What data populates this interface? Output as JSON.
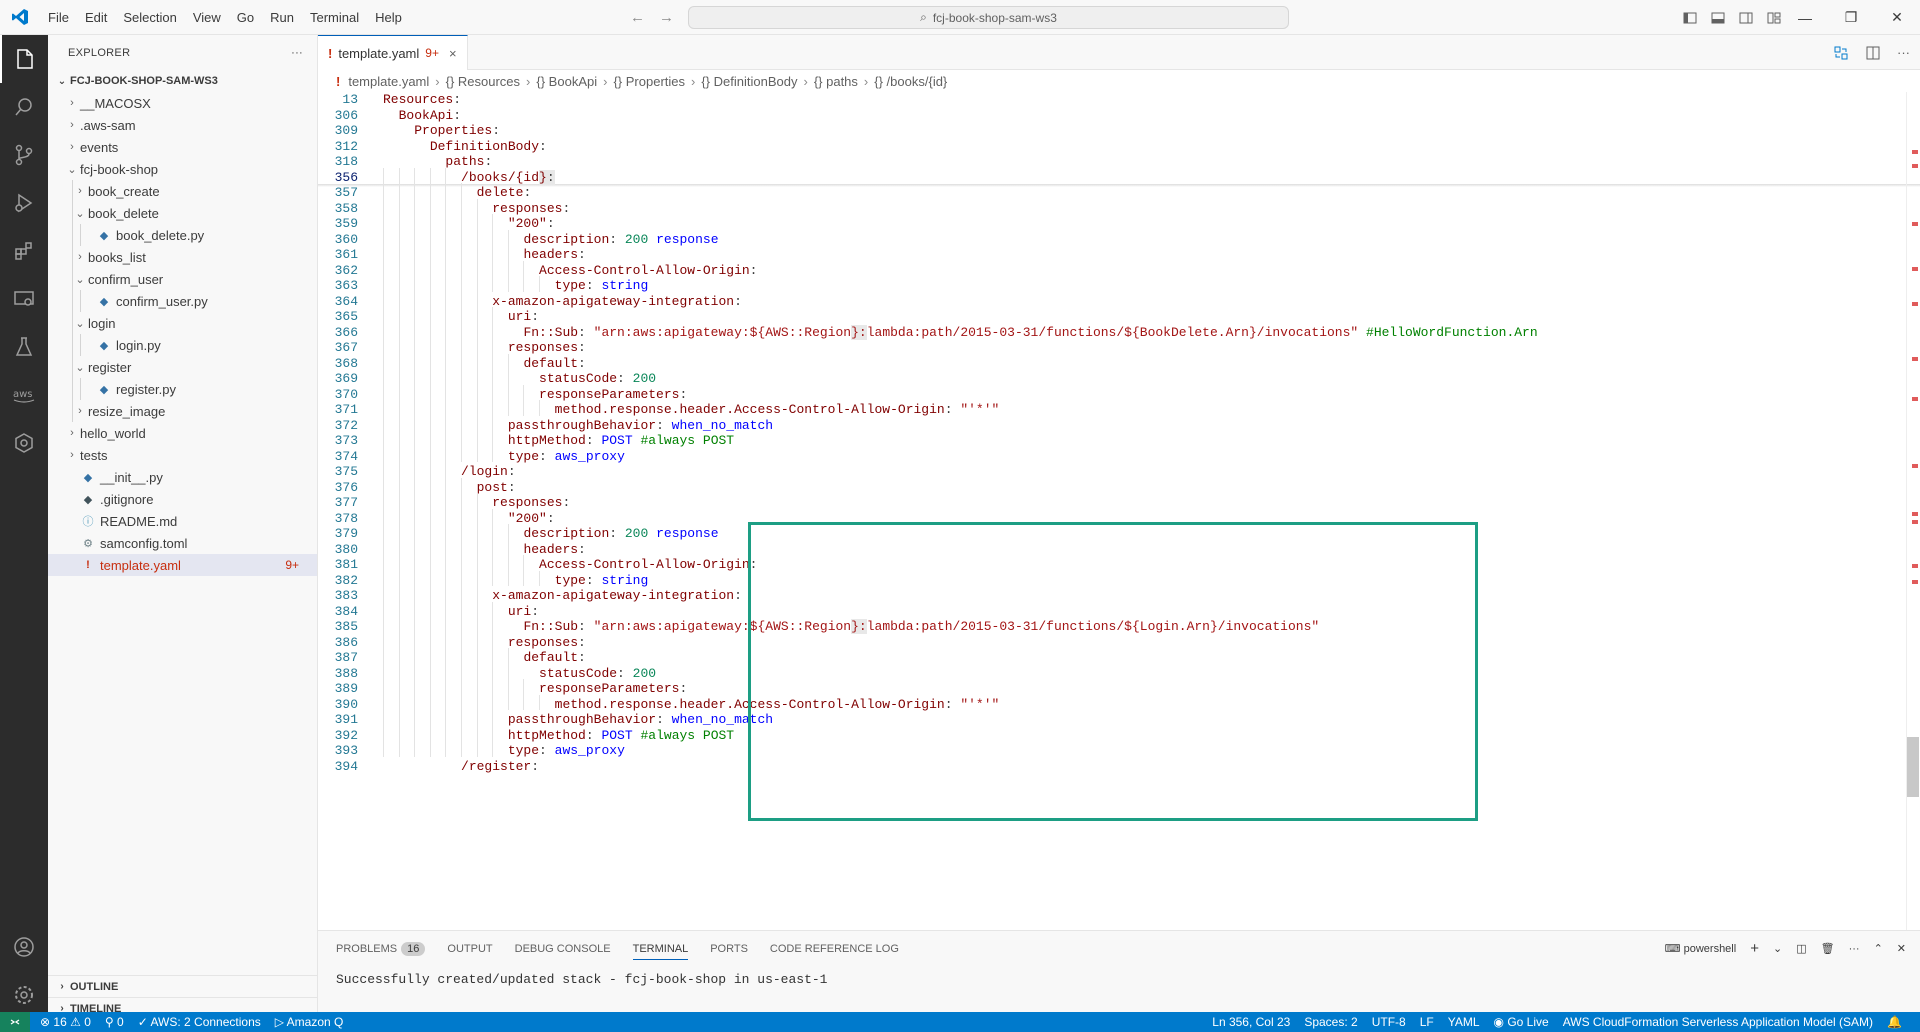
{
  "titlebar": {
    "menu": [
      "File",
      "Edit",
      "Selection",
      "View",
      "Go",
      "Run",
      "Terminal",
      "Help"
    ],
    "search": "fcj-book-shop-sam-ws3"
  },
  "sidebar": {
    "title": "EXPLORER",
    "more": "···",
    "root": "FCJ-BOOK-SHOP-SAM-WS3",
    "items": [
      {
        "label": "__MACOSX",
        "depth": 1,
        "kind": "folder",
        "open": false
      },
      {
        "label": ".aws-sam",
        "depth": 1,
        "kind": "folder",
        "open": false
      },
      {
        "label": "events",
        "depth": 1,
        "kind": "folder",
        "open": false
      },
      {
        "label": "fcj-book-shop",
        "depth": 1,
        "kind": "folder",
        "open": true
      },
      {
        "label": "book_create",
        "depth": 2,
        "kind": "folder",
        "open": false
      },
      {
        "label": "book_delete",
        "depth": 2,
        "kind": "folder",
        "open": true
      },
      {
        "label": "book_delete.py",
        "depth": 3,
        "kind": "py"
      },
      {
        "label": "books_list",
        "depth": 2,
        "kind": "folder",
        "open": false
      },
      {
        "label": "confirm_user",
        "depth": 2,
        "kind": "folder",
        "open": true
      },
      {
        "label": "confirm_user.py",
        "depth": 3,
        "kind": "py"
      },
      {
        "label": "login",
        "depth": 2,
        "kind": "folder",
        "open": true
      },
      {
        "label": "login.py",
        "depth": 3,
        "kind": "py"
      },
      {
        "label": "register",
        "depth": 2,
        "kind": "folder",
        "open": true
      },
      {
        "label": "register.py",
        "depth": 3,
        "kind": "py"
      },
      {
        "label": "resize_image",
        "depth": 2,
        "kind": "folder",
        "open": false
      },
      {
        "label": "hello_world",
        "depth": 1,
        "kind": "folder",
        "open": false
      },
      {
        "label": "tests",
        "depth": 1,
        "kind": "folder",
        "open": false
      },
      {
        "label": "__init__.py",
        "depth": 1,
        "kind": "py"
      },
      {
        "label": ".gitignore",
        "depth": 1,
        "kind": "git"
      },
      {
        "label": "README.md",
        "depth": 1,
        "kind": "info"
      },
      {
        "label": "samconfig.toml",
        "depth": 1,
        "kind": "gear"
      },
      {
        "label": "template.yaml",
        "depth": 1,
        "kind": "yaml",
        "selected": true,
        "badge": "9+"
      }
    ],
    "outline": "OUTLINE",
    "timeline": "TIMELINE"
  },
  "editor": {
    "tab": {
      "icon": "!",
      "label": "template.yaml",
      "count": "9+",
      "close": "×"
    },
    "breadcrumb": [
      "template.yaml",
      "{} Resources",
      "{} BookApi",
      "{} Properties",
      "{} DefinitionBody",
      "{} paths",
      "{} /books/{id}"
    ],
    "lines": [
      {
        "n": "13",
        "html": "<span class='k'>Resources</span><span class='p'>:</span>"
      },
      {
        "n": "306",
        "html": "  <span class='k'>BookApi</span><span class='p'>:</span>"
      },
      {
        "n": "309",
        "html": "    <span class='k'>Properties</span><span class='p'>:</span>"
      },
      {
        "n": "312",
        "html": "      <span class='k'>DefinitionBody</span><span class='p'>:</span>"
      },
      {
        "n": "318",
        "html": "        <span class='k'>paths</span><span class='p'>:</span>"
      },
      {
        "n": "356",
        "cur": true,
        "html": "          <span class='k'>/books/{id<span class='hl'>}</span></span><span class='p hl'>:</span>"
      },
      {
        "n": "357",
        "html": "            <span class='k'>delete</span><span class='p'>:</span>"
      },
      {
        "n": "358",
        "html": "              <span class='k'>responses</span><span class='p'>:</span>"
      },
      {
        "n": "359",
        "html": "                <span class='k'>\"200\"</span><span class='p'>:</span>"
      },
      {
        "n": "360",
        "html": "                  <span class='k'>description</span><span class='p'>: </span><span class='n'>200</span> <span class='v'>response</span>"
      },
      {
        "n": "361",
        "html": "                  <span class='k'>headers</span><span class='p'>:</span>"
      },
      {
        "n": "362",
        "html": "                    <span class='k'>Access-Control-Allow-Origin</span><span class='p'>:</span>"
      },
      {
        "n": "363",
        "html": "                      <span class='k'>type</span><span class='p'>: </span><span class='v'>string</span>"
      },
      {
        "n": "364",
        "html": "              <span class='k'>x-amazon-apigateway-integration</span><span class='p'>:</span>"
      },
      {
        "n": "365",
        "html": "                <span class='k'>uri</span><span class='p'>:</span>"
      },
      {
        "n": "366",
        "html": "                  <span class='k'>Fn::Sub</span><span class='p'>: </span><span class='s'>\"arn:aws:apigateway:${AWS::Region<span class='hl'>}:</span>lambda:path/2015-03-31/functions/${BookDelete.Arn}/invocations\"</span> <span class='c'>#HelloWordFunction.Arn</span>"
      },
      {
        "n": "367",
        "html": "                <span class='k'>responses</span><span class='p'>:</span>"
      },
      {
        "n": "368",
        "html": "                  <span class='k'>default</span><span class='p'>:</span>"
      },
      {
        "n": "369",
        "html": "                    <span class='k'>statusCode</span><span class='p'>: </span><span class='n'>200</span>"
      },
      {
        "n": "370",
        "html": "                    <span class='k'>responseParameters</span><span class='p'>:</span>"
      },
      {
        "n": "371",
        "html": "                      <span class='k'>method.response.header.Access-Control-Allow-Origin</span><span class='p'>: </span><span class='s'>\"'*'\"</span>"
      },
      {
        "n": "372",
        "html": "                <span class='k'>passthroughBehavior</span><span class='p'>: </span><span class='v'>when_no_match</span>"
      },
      {
        "n": "373",
        "html": "                <span class='k'>httpMethod</span><span class='p'>: </span><span class='v'>POST</span> <span class='c'>#always POST</span>"
      },
      {
        "n": "374",
        "html": "                <span class='k'>type</span><span class='p'>: </span><span class='v'>aws_proxy</span>"
      },
      {
        "n": "375",
        "html": "          <span class='k'>/login</span><span class='p'>:</span>"
      },
      {
        "n": "376",
        "html": "            <span class='k'>post</span><span class='p'>:</span>"
      },
      {
        "n": "377",
        "html": "              <span class='k'>responses</span><span class='p'>:</span>"
      },
      {
        "n": "378",
        "html": "                <span class='k'>\"200\"</span><span class='p'>:</span>"
      },
      {
        "n": "379",
        "html": "                  <span class='k'>description</span><span class='p'>: </span><span class='n'>200</span> <span class='v'>response</span>"
      },
      {
        "n": "380",
        "html": "                  <span class='k'>headers</span><span class='p'>:</span>"
      },
      {
        "n": "381",
        "html": "                    <span class='k'>Access-Control-Allow-Origin</span><span class='p'>:</span>"
      },
      {
        "n": "382",
        "html": "                      <span class='k'>type</span><span class='p'>: </span><span class='v'>string</span>"
      },
      {
        "n": "383",
        "html": "              <span class='k'>x-amazon-apigateway-integration</span><span class='p'>:</span>"
      },
      {
        "n": "384",
        "html": "                <span class='k'>uri</span><span class='p'>:</span>"
      },
      {
        "n": "385",
        "html": "                  <span class='k'>Fn::Sub</span><span class='p'>: </span><span class='s'>\"arn:aws:apigateway:${AWS::Region<span class='hl'>}:</span>lambda:path/2015-03-31/functions/${Login.Arn}/invocations\"</span>"
      },
      {
        "n": "386",
        "html": "                <span class='k'>responses</span><span class='p'>:</span>"
      },
      {
        "n": "387",
        "html": "                  <span class='k'>default</span><span class='p'>:</span>"
      },
      {
        "n": "388",
        "html": "                    <span class='k'>statusCode</span><span class='p'>: </span><span class='n'>200</span>"
      },
      {
        "n": "389",
        "html": "                    <span class='k'>responseParameters</span><span class='p'>:</span>"
      },
      {
        "n": "390",
        "html": "                      <span class='k'>method.response.header.Access-Control-Allow-Origin</span><span class='p'>: </span><span class='s'>\"'*'\"</span>"
      },
      {
        "n": "391",
        "html": "                <span class='k'>passthroughBehavior</span><span class='p'>: </span><span class='v'>when_no_match</span>"
      },
      {
        "n": "392",
        "html": "                <span class='k'>httpMethod</span><span class='p'>: </span><span class='v'>POST</span> <span class='c'>#always POST</span>"
      },
      {
        "n": "393",
        "html": "                <span class='k'>type</span><span class='p'>: </span><span class='v'>aws_proxy</span>"
      },
      {
        "n": "394",
        "html": "          <span class='k'>/register</span><span class='p'>:</span>"
      }
    ]
  },
  "panel": {
    "tabs": [
      "PROBLEMS",
      "OUTPUT",
      "DEBUG CONSOLE",
      "TERMINAL",
      "PORTS",
      "CODE REFERENCE LOG"
    ],
    "problems_count": "16",
    "active_tab": "TERMINAL",
    "shell": "powershell",
    "output": "Successfully created/updated stack - fcj-book-shop in us-east-1"
  },
  "statusbar": {
    "errors": "16",
    "warnings": "0",
    "ports": "0",
    "aws": "AWS: 2 Connections",
    "amazonq": "Amazon Q",
    "position": "Ln 356, Col 23",
    "spaces": "Spaces: 2",
    "encoding": "UTF-8",
    "eol": "LF",
    "language": "YAML",
    "golive": "Go Live",
    "schema": "AWS CloudFormation Serverless Application Model (SAM)"
  },
  "colors": {
    "accent": "#005fb8",
    "statusbar": "#007acc",
    "selection_box": "#1d9e84",
    "error": "#c72e0f"
  }
}
